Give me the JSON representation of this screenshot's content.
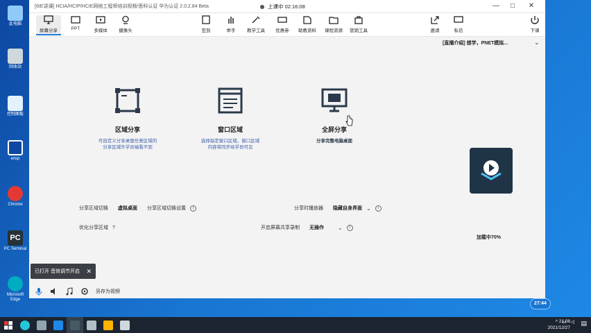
{
  "window": {
    "title": "[6IE讲课] HCIA/HCIP/HCIE网络工程师培训视频/思科认证 华为认证 2.0.2.84 Beta",
    "status": "上课中 02:16:08"
  },
  "toolbar": {
    "left": [
      {
        "label": "屏幕分享",
        "icon": "screen-share-icon"
      },
      {
        "label": "PPT",
        "icon": "ppt-icon"
      },
      {
        "label": "多媒体",
        "icon": "media-icon"
      },
      {
        "label": "摄像头",
        "icon": "camera-icon"
      }
    ],
    "center": [
      {
        "label": "签到",
        "icon": "checkin-icon"
      },
      {
        "label": "举手",
        "icon": "raise-hand-icon"
      },
      {
        "label": "教学工具",
        "icon": "tools-icon"
      },
      {
        "label": "优惠券",
        "icon": "coupon-icon"
      },
      {
        "label": "助教资料",
        "icon": "materials-icon"
      },
      {
        "label": "课程资源",
        "icon": "resources-icon"
      },
      {
        "label": "营销工具",
        "icon": "marketing-icon"
      }
    ],
    "right": [
      {
        "label": "邀请",
        "icon": "invite-icon"
      },
      {
        "label": "私信",
        "icon": "message-icon"
      },
      {
        "label": "下课",
        "icon": "end-class-icon"
      }
    ]
  },
  "banner": "[直播介绍] 想学，PNET模拟...",
  "modes": [
    {
      "name": "区域分享",
      "desc": "可自定义分享桌面任意区域的\n分享区域外学员端看不到"
    },
    {
      "name": "窗口区域",
      "desc": "选择指定窗口区域，窗口区域\n内容将同步给学员可见"
    },
    {
      "name": "全屏分享",
      "desc": "分享完整电脑桌面"
    }
  ],
  "options": {
    "row1_left_label": "分享区域切换",
    "row1_left_value": "虚拟桌面",
    "row1_left_hint": "分享区域切换设置",
    "row1_right_label": "分享时播放器",
    "row1_right_value": "隐藏自身界面",
    "row2_left_label": "优化分享区域",
    "row2_right_label": "开启屏幕共享录制",
    "row2_right_value": "无操作"
  },
  "loading_text": "加载中70%",
  "toast": {
    "text": "已打开 音效调节开启"
  },
  "bottombar": {
    "label": "另存为视频"
  },
  "timer": "27:44",
  "taskbar": {
    "time": "21:08",
    "date": "2021/12/27"
  },
  "desktop_icons": [
    "此电脑",
    "回收站",
    "控制面板",
    "ensp",
    "Chrome",
    "PC Terminal",
    "Microsoft Edge"
  ]
}
